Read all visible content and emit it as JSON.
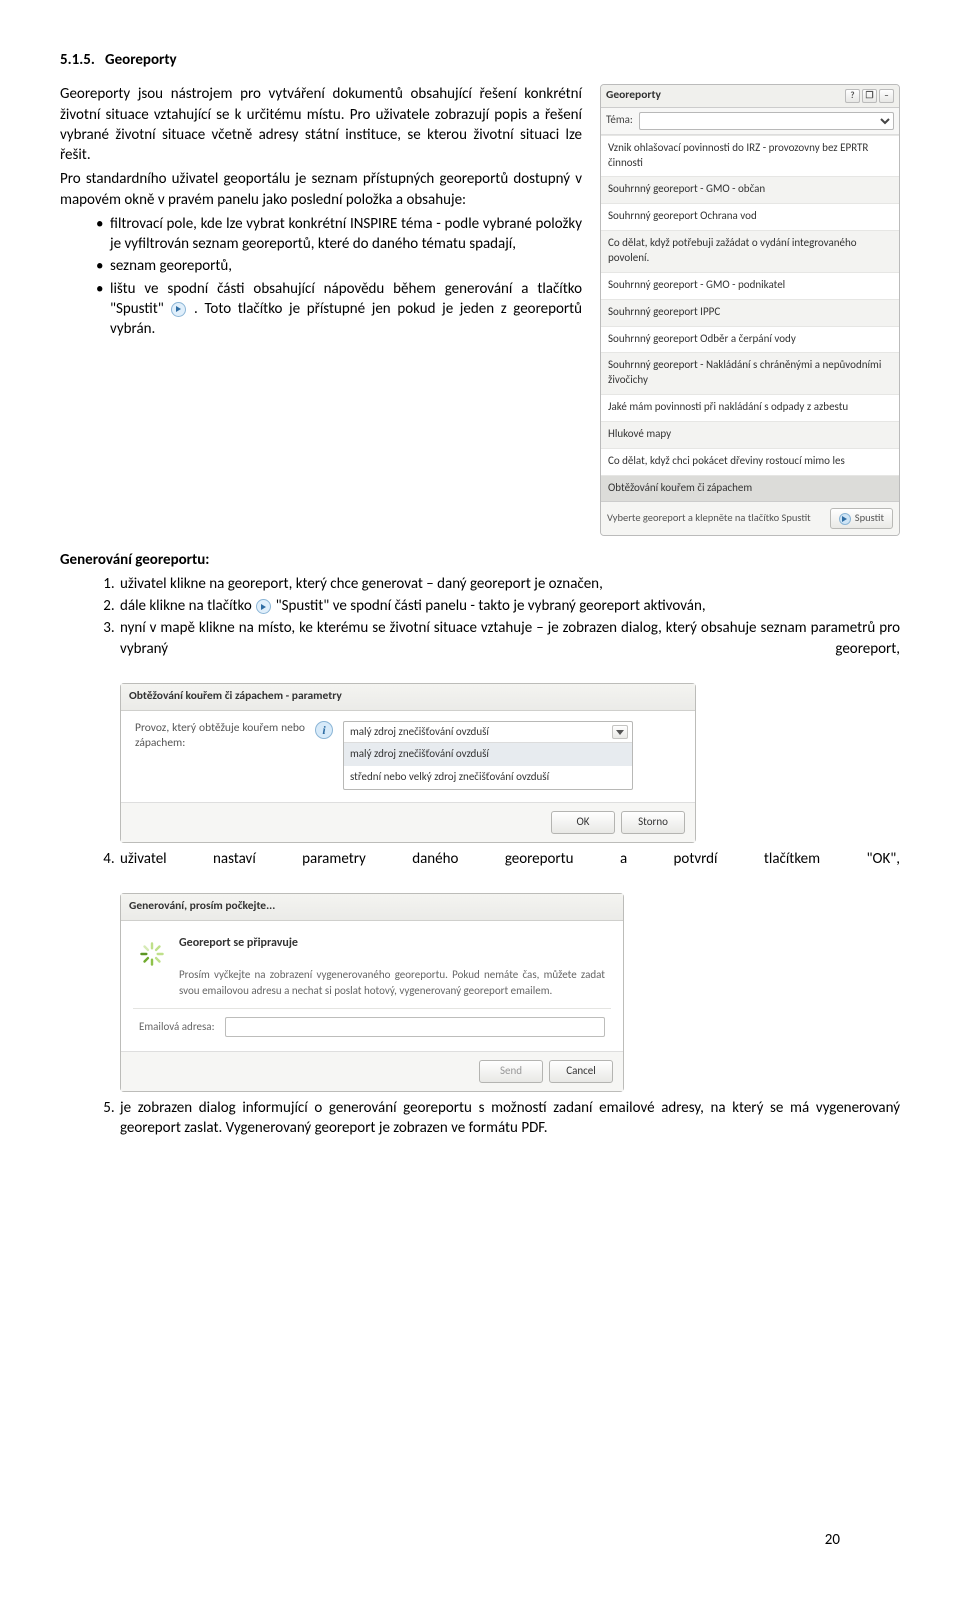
{
  "section": {
    "number": "5.1.5.",
    "title": "Georeporty"
  },
  "para1": "Georeporty jsou nástrojem pro vytváření dokumentů obsahující řešení konkrétní životní situace vztahující se k určitému místu. Pro uživatele zobrazují popis a řešení vybrané životní situace včetně adresy státní instituce, se kterou životní situaci lze řešit.",
  "para2": "Pro standardního uživatel geoportálu je seznam přístupných georeportů dostupný v mapovém okně v pravém panelu jako poslední položka a obsahuje:",
  "bullets": {
    "b1": "filtrovací pole, kde lze vybrat konkrétní INSPIRE téma - podle vybrané položky je vyfiltrován seznam georeportů, které do daného tématu spadají,",
    "b2": "seznam georeportů,",
    "b3a": "lištu ve spodní části obsahující nápovědu během generování a tlačítko \"Spustit\" ",
    "b3b": ". Toto tlačítko je přístupné jen pokud je jeden z georeportů vybrán."
  },
  "gen_heading": "Generování georeportu:",
  "steps": {
    "s1": "uživatel klikne na georeport, který chce generovat – daný georeport je označen,",
    "s2a": "dále klikne na tlačítko ",
    "s2b": " \"Spustit\" ve spodní části panelu - takto je vybraný georeport aktivován,",
    "s3": "nyní v mapě klikne na místo, ke kterému se životní situace vztahuje – je zobrazen dialog, který obsahuje seznam parametrů pro vybraný georeport,",
    "s4": "uživatel nastaví parametry daného georeportu a potvrdí tlačítkem \"OK\",",
    "s5": "je zobrazen dialog informující o generování georeportu s možností zadaní emailové adresy, na který se má vygenerovaný georeport zaslat. Vygenerovaný georeport je zobrazen ve formátu PDF."
  },
  "panel": {
    "title": "Georeporty",
    "theme_label": "Téma:",
    "theme_value": "",
    "items": [
      "Vznik ohlašovací povinnosti do IRZ - provozovny bez EPRTR činnosti",
      "Souhrnný georeport - GMO - občan",
      "Souhrnný georeport Ochrana vod",
      "Co dělat, když potřebuji zažádat o vydání integrovaného povolení.",
      "Souhrnný georeport - GMO - podnikatel",
      "Souhrnný georeport IPPC",
      "Souhrnný georeport Odběr a čerpání vody",
      "Souhrnný georeport - Nakládání s chráněnými a nepůvodními živočichy",
      "Jaké mám povinnosti při nakládání s odpady z azbestu",
      "Hlukové mapy",
      "Co dělat, když chci pokácet dřeviny rostoucí mimo les",
      "Obtěžování kouřem či zápachem"
    ],
    "footer_hint": "Vyberte georeport a klepněte na tlačítko Spustit",
    "run_btn": "Spustit"
  },
  "dialog1": {
    "title": "Obtěžování kouřem či zápachem - parametry",
    "param_label": "Provoz, který obtěžuje kouřem nebo zápachem:",
    "selected": "malý zdroj znečišťování ovzduší",
    "options": [
      "malý zdroj znečišťování ovzduší",
      "střední nebo velký zdroj znečišťování ovzduší"
    ],
    "ok": "OK",
    "cancel": "Storno"
  },
  "dialog2": {
    "title": "Generování, prosím počkejte...",
    "heading": "Georeport se připravuje",
    "body": "Prosím vyčkejte na zobrazení vygenerovaného georeportu. Pokud nemáte čas, můžete zadat svou emailovou adresu a nechat si poslat hotový, vygenerovaný georeport emailem.",
    "email_label": "Emailová adresa:",
    "send": "Send",
    "cancel": "Cancel"
  },
  "page_number": "20"
}
